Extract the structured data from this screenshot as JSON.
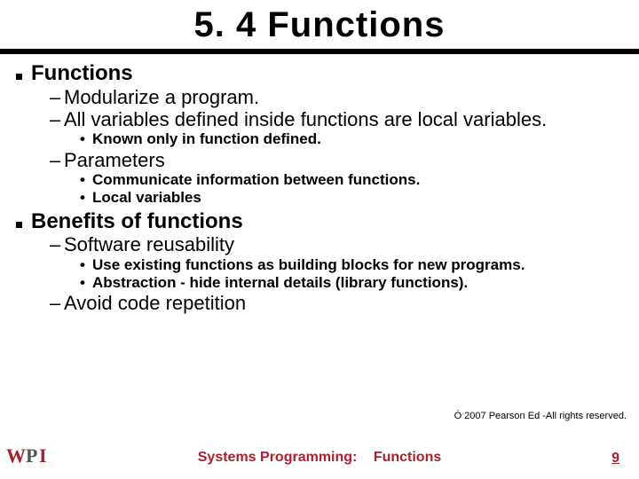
{
  "title": "5. 4 Functions",
  "sections": [
    {
      "label": "Functions",
      "dashes": [
        {
          "text": "Modularize a program.",
          "dots": []
        },
        {
          "text": "All variables defined inside functions are local variables.",
          "dots": [
            "Known only in function defined."
          ]
        },
        {
          "text": "Parameters",
          "dots": [
            "Communicate information between functions.",
            "Local variables"
          ]
        }
      ]
    },
    {
      "label": "Benefits of functions",
      "dashes": [
        {
          "text": "Software reusability",
          "dots": [
            "Use existing functions as building blocks for new programs.",
            "Abstraction - hide internal details (library functions)."
          ]
        },
        {
          "text": "Avoid code repetition",
          "dots": []
        }
      ]
    }
  ],
  "copyright": "Ó 2007 Pearson Ed -All rights reserved.",
  "footer": {
    "left_label": "Systems Programming:",
    "right_label": "Functions"
  },
  "page_number": "9",
  "logo_text": "WPI"
}
